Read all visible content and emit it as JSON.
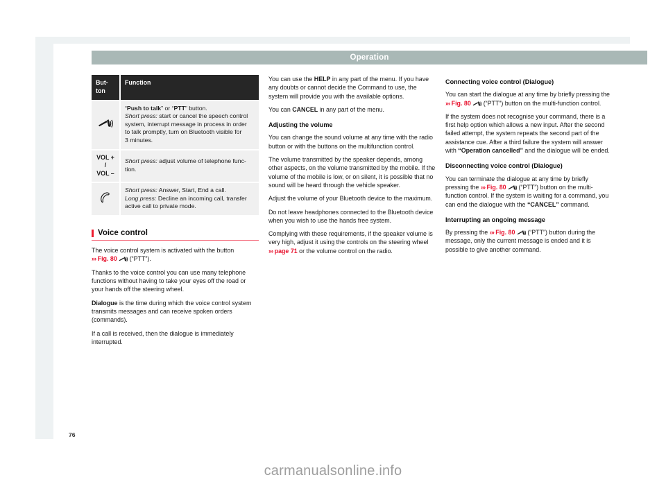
{
  "header": {
    "title": "Operation"
  },
  "page": {
    "number": "76"
  },
  "watermark": {
    "text": "carmanualsonline.info"
  },
  "table": {
    "headers": {
      "button": "But-\nton",
      "button_line1": "But-",
      "button_line2": "ton",
      "function": "Function"
    },
    "rows": [
      {
        "button_icon": "push-to-talk-icon",
        "button_label": "",
        "lines": [
          {
            "parts": [
              {
                "t": "“",
                "s": "n"
              },
              {
                "t": "Push to talk",
                "s": "b"
              },
              {
                "t": "” or “",
                "s": "n"
              },
              {
                "t": "PTT",
                "s": "b"
              },
              {
                "t": "” button.",
                "s": "n"
              }
            ]
          },
          {
            "parts": [
              {
                "t": "Short press:",
                "s": "i"
              },
              {
                "t": " start or cancel the speech control",
                "s": "n"
              }
            ]
          },
          {
            "parts": [
              {
                "t": "system, interrupt message in process in order",
                "s": "n"
              }
            ]
          },
          {
            "parts": [
              {
                "t": "to talk promptly, turn on Bluetooth visible for",
                "s": "n"
              }
            ]
          },
          {
            "parts": [
              {
                "t": "3 minutes.",
                "s": "n"
              }
            ]
          }
        ]
      },
      {
        "button_icon": "",
        "button_label_line1": "VOL + /",
        "button_label_line2": "VOL –",
        "lines": [
          {
            "parts": [
              {
                "t": "Short press:",
                "s": "i"
              },
              {
                "t": " adjust volume of telephone func-",
                "s": "n"
              }
            ]
          },
          {
            "parts": [
              {
                "t": "tion.",
                "s": "n"
              }
            ]
          }
        ]
      },
      {
        "button_icon": "phone-handset-icon",
        "button_label": "",
        "lines": [
          {
            "parts": [
              {
                "t": "Short press:",
                "s": "i"
              },
              {
                "t": " Answer, Start, End a call.",
                "s": "n"
              }
            ]
          },
          {
            "parts": [
              {
                "t": "Long press:",
                "s": "i"
              },
              {
                "t": " Decline an incoming call, transfer",
                "s": "n"
              }
            ]
          },
          {
            "parts": [
              {
                "t": "active call to private mode.",
                "s": "n"
              }
            ]
          }
        ]
      }
    ]
  },
  "voice_control": {
    "heading": "Voice control",
    "p1_a": "The voice control system is activated with the button ",
    "p1_xref": "Fig. 80",
    "p1_b": " (“PTT”).",
    "p2": "Thanks to the voice control you can use many telephone functions without having to take your eyes off the road or your hands off the steering wheel.",
    "p3_bold": "Dialogue",
    "p3_rest": " is the time during which the voice control system transmits messages and can receive spoken orders (commands).",
    "p4": "If a call is received, then the dialogue is immediately interrupted."
  },
  "col2": {
    "p1_a": "You can use the ",
    "p1_help": "HELP",
    "p1_b": " in any part of the menu. If you have any doubts or cannot decide the Command to use, the system will provide you with the available options.",
    "p2_a": "You can ",
    "p2_cancel": "CANCEL",
    "p2_b": " in any part of the menu.",
    "heading_volume": "Adjusting the volume",
    "p3": "You can change the sound volume at any time with the radio button or with the buttons on the multifunction control.",
    "p4": "The volume transmitted by the speaker depends, among other aspects, on the volume transmitted by the mobile. If the volume of the mobile is low, or on silent, it is possible that no sound will be heard through the vehicle speaker.",
    "p5": "Adjust the volume of your Bluetooth device to the maximum.",
    "p6": "Do not leave headphones connected to the Bluetooth device when you wish to use the hands free system.",
    "p7_a": "Complying with these requirements, if the speaker volume is very high, adjust it using the controls on the steering wheel ",
    "p7_xref": "page 71",
    "p7_b": " or the volume control on the radio."
  },
  "col3": {
    "heading_connecting": "Connecting voice control (Dialogue)",
    "p1_a": "You can start the dialogue at any time by briefly pressing the ",
    "p1_xref": "Fig. 80",
    "p1_b": " (“PTT”) button on the multi-function control.",
    "p2_a": "If the system does not recognise your command, there is a first help option which allows a new input. After the second failed attempt, the system repeats the second part of the assistance cue. After a third failure the system will answer with ",
    "p2_bold": "“Operation cancelled”",
    "p2_b": " and the dialogue will be ended.",
    "heading_disconnecting": "Disconnecting voice control (Dialogue)",
    "p3_a": "You can terminate the dialogue at any time by briefly pressing the ",
    "p3_xref": "Fig. 80",
    "p3_b": " (“PTT”) button on the multi-function control. If the system is waiting for a command, you can end the dialogue with the ",
    "p3_bold": "“CANCEL”",
    "p3_c": " command.",
    "heading_interrupting": "Interrupting an ongoing message",
    "p4_a": "By pressing the ",
    "p4_xref": "Fig. 80",
    "p4_b": " (“PTT”) button during the message, only the current message is ended and it is possible to give another command."
  },
  "colors": {
    "header_bar": "#a9b8b6",
    "accent_red": "#ed1c2e",
    "rule_pink": "#f4697a",
    "table_header": "#262626",
    "table_cell": "#f0f0f0",
    "page_frame": "#eef2f3"
  }
}
